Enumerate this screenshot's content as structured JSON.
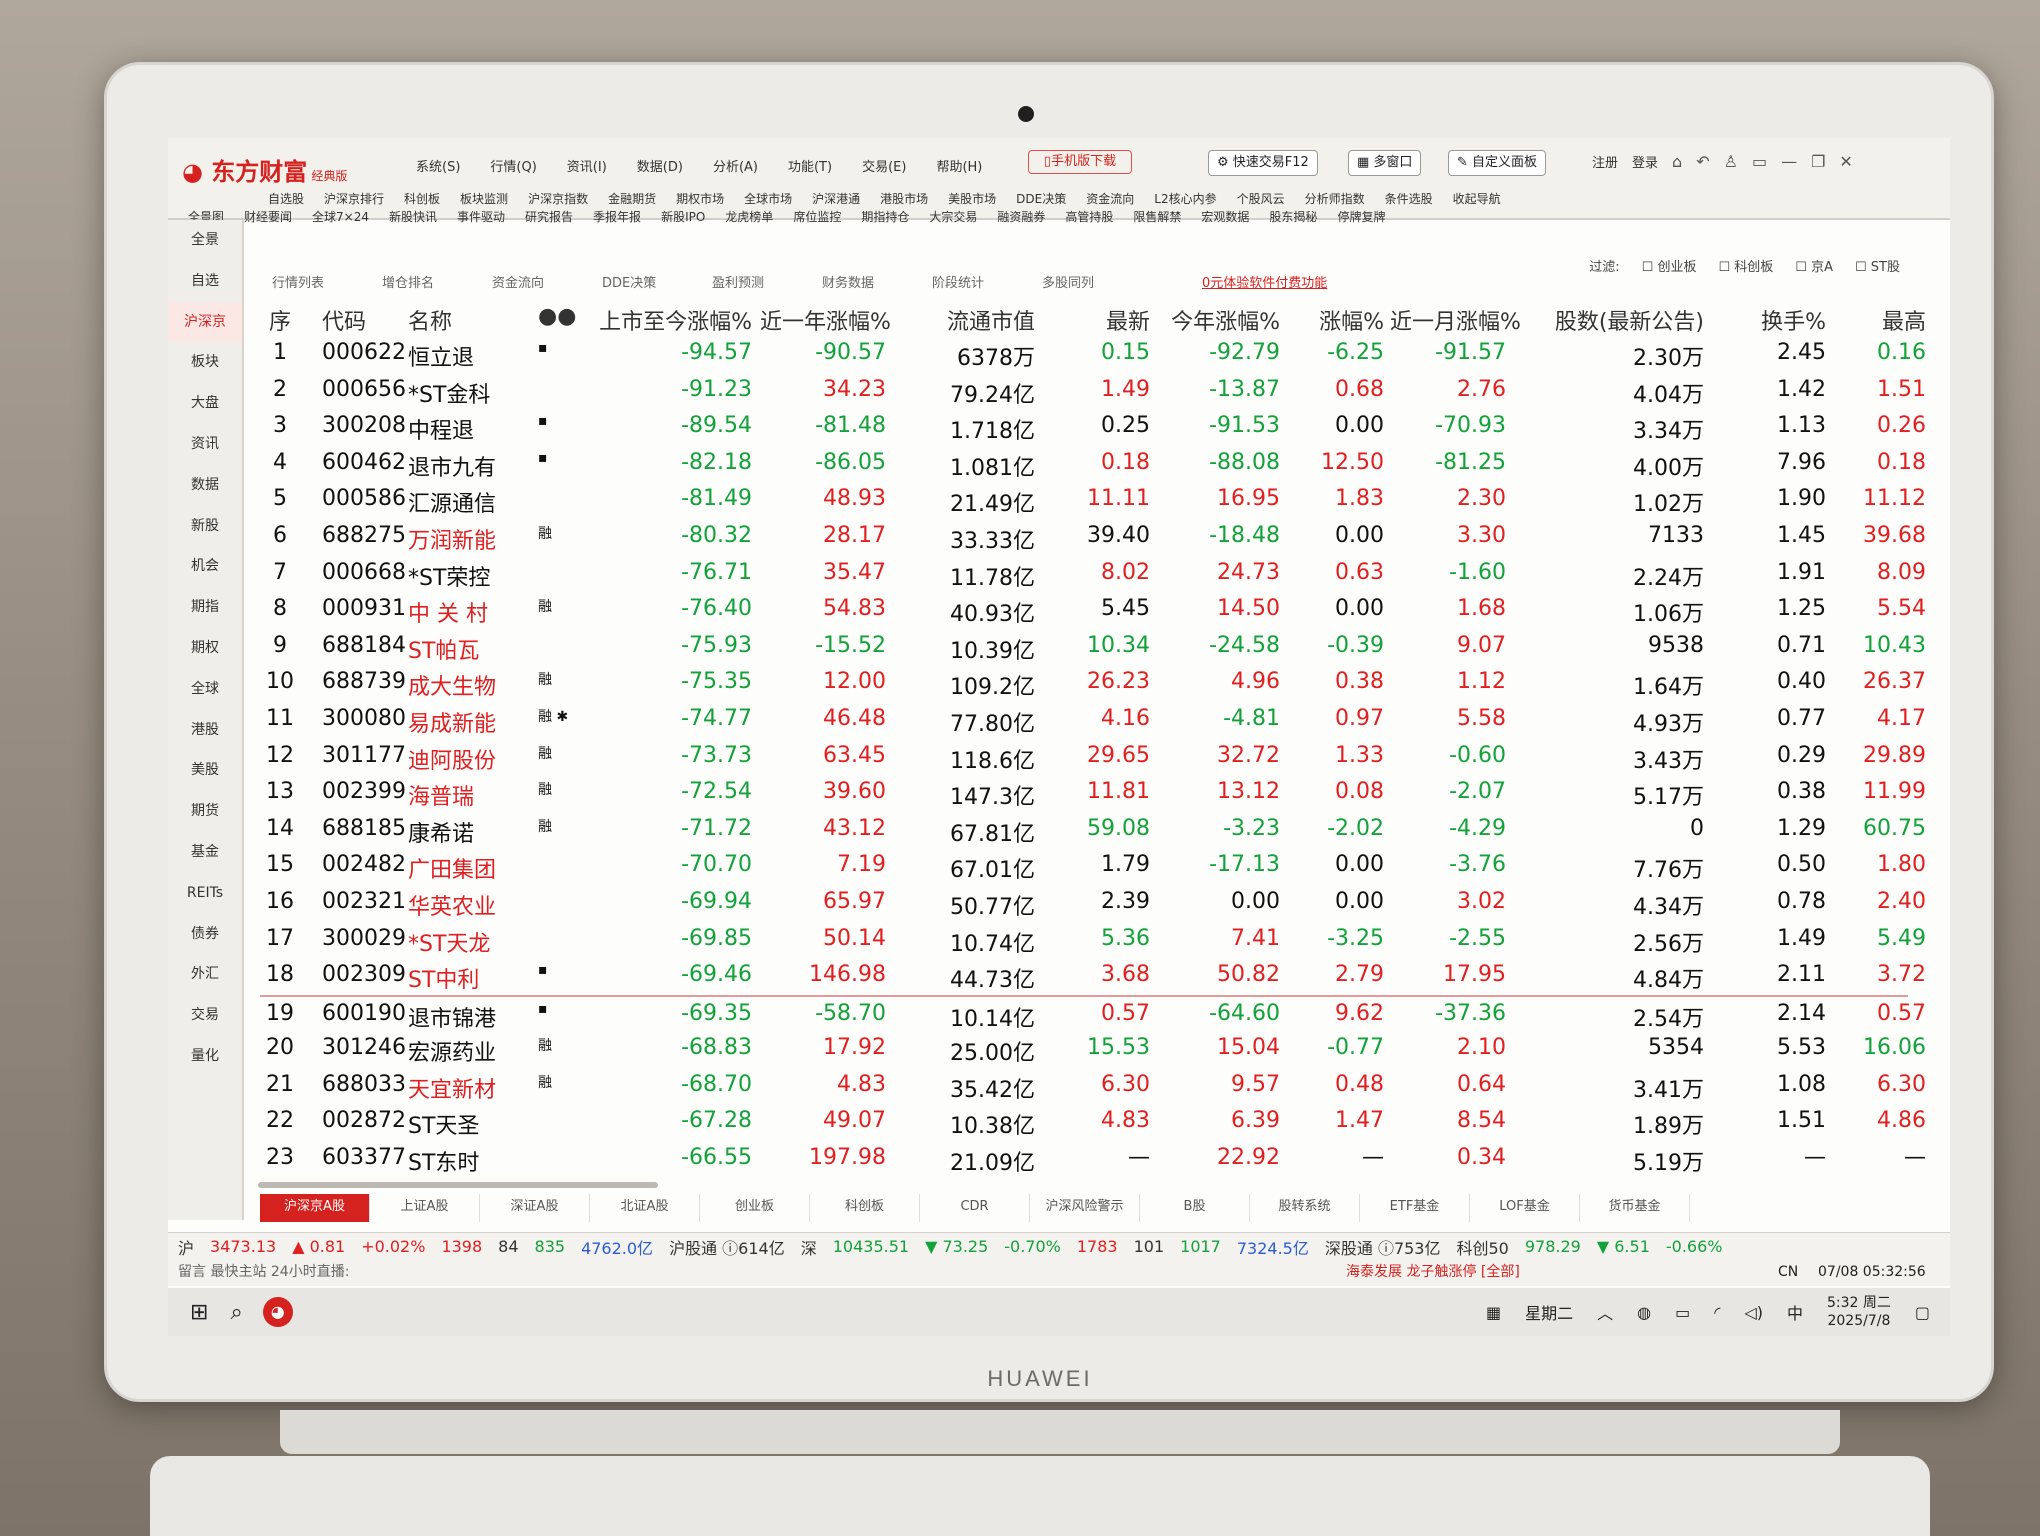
{
  "device": {
    "brand": "HUAWEI"
  },
  "app": {
    "logo": "东方财富",
    "logo_sub": "经典版",
    "menu": [
      "系统(S)",
      "行情(Q)",
      "资讯(I)",
      "数据(D)",
      "分析(A)",
      "功能(T)",
      "交易(E)",
      "帮助(H)"
    ],
    "mobile_download": "手机版下载",
    "quick_trade": "快速交易F12",
    "multi_window": "多窗口",
    "custom_panel": "自定义面板",
    "register": "注册",
    "login": "登录"
  },
  "subnav_row1": [
    "自选股",
    "沪深京排行",
    "科创板",
    "板块监测",
    "沪深京指数",
    "金融期货",
    "期权市场",
    "全球市场",
    "沪深港通",
    "港股市场",
    "美股市场",
    "DDE决策",
    "资金流向",
    "L2核心内参",
    "个股风云",
    "分析师指数",
    "条件选股",
    "收起导航"
  ],
  "subnav_row2": [
    "全景图",
    "财经要闻",
    "全球7×24",
    "新股快讯",
    "事件驱动",
    "研究报告",
    "季报年报",
    "新股IPO",
    "龙虎榜单",
    "席位监控",
    "期指持仓",
    "大宗交易",
    "融资融券",
    "高管持股",
    "限售解禁",
    "宏观数据",
    "股东揭秘",
    "停牌复牌"
  ],
  "sidebar": [
    "全景",
    "自选",
    "沪深京",
    "板块",
    "大盘",
    "资讯",
    "数据",
    "新股",
    "机会",
    "期指",
    "期权",
    "全球",
    "港股",
    "美股",
    "期货",
    "基金",
    "REITs",
    "债券",
    "外汇",
    "交易",
    "量化"
  ],
  "tabs": [
    "行情列表",
    "增仓排名",
    "资金流向",
    "DDE决策",
    "盈利预测",
    "财务数据",
    "阶段统计",
    "多股同列"
  ],
  "promo": "0元体验软件付费功能",
  "filter": {
    "label": "过滤:",
    "options": [
      "创业板",
      "科创板",
      "京A",
      "ST股"
    ]
  },
  "columns": {
    "seq": "序",
    "code": "代码",
    "name": "名称",
    "ipo_chg": "上市至今涨幅%",
    "yr1_chg": "近一年涨幅%",
    "mcap": "流通市值",
    "last": "最新",
    "ytd_chg": "今年涨幅%",
    "chg": "涨幅%",
    "m1_chg": "近一月涨幅%",
    "shares": "股数(最新公告)",
    "turnover": "换手%",
    "high": "最高"
  },
  "rows": [
    {
      "seq": "1",
      "code": "000622",
      "name": "恒立退",
      "mark": "▪",
      "ipo": "-94.57",
      "yr1": "-90.57",
      "mcap": "6378万",
      "last": "0.15",
      "ytd": "-92.79",
      "chg": "-6.25",
      "m1": "-91.57",
      "shares": "2.30万",
      "turn": "2.45",
      "high": "0.16"
    },
    {
      "seq": "2",
      "code": "000656",
      "name": "*ST金科",
      "mark": "",
      "ipo": "-91.23",
      "yr1": "34.23",
      "mcap": "79.24亿",
      "last": "1.49",
      "ytd": "-13.87",
      "chg": "0.68",
      "m1": "2.76",
      "shares": "4.04万",
      "turn": "1.42",
      "high": "1.51"
    },
    {
      "seq": "3",
      "code": "300208",
      "name": "中程退",
      "mark": "▪",
      "ipo": "-89.54",
      "yr1": "-81.48",
      "mcap": "1.718亿",
      "last": "0.25",
      "ytd": "-91.53",
      "chg": "0.00",
      "m1": "-70.93",
      "shares": "3.34万",
      "turn": "1.13",
      "high": "0.26"
    },
    {
      "seq": "4",
      "code": "600462",
      "name": "退市九有",
      "mark": "▪",
      "ipo": "-82.18",
      "yr1": "-86.05",
      "mcap": "1.081亿",
      "last": "0.18",
      "ytd": "-88.08",
      "chg": "12.50",
      "m1": "-81.25",
      "shares": "4.00万",
      "turn": "7.96",
      "high": "0.18"
    },
    {
      "seq": "5",
      "code": "000586",
      "name": "汇源通信",
      "mark": "",
      "ipo": "-81.49",
      "yr1": "48.93",
      "mcap": "21.49亿",
      "last": "11.11",
      "ytd": "16.95",
      "chg": "1.83",
      "m1": "2.30",
      "shares": "1.02万",
      "turn": "1.90",
      "high": "11.12"
    },
    {
      "seq": "6",
      "code": "688275",
      "name": "万润新能",
      "mark": "融",
      "ipo": "-80.32",
      "yr1": "28.17",
      "mcap": "33.33亿",
      "last": "39.40",
      "ytd": "-18.48",
      "chg": "0.00",
      "m1": "3.30",
      "shares": "7133",
      "turn": "1.45",
      "high": "39.68"
    },
    {
      "seq": "7",
      "code": "000668",
      "name": "*ST荣控",
      "mark": "",
      "ipo": "-76.71",
      "yr1": "35.47",
      "mcap": "11.78亿",
      "last": "8.02",
      "ytd": "24.73",
      "chg": "0.63",
      "m1": "-1.60",
      "shares": "2.24万",
      "turn": "1.91",
      "high": "8.09"
    },
    {
      "seq": "8",
      "code": "000931",
      "name": "中 关 村",
      "mark": "融",
      "ipo": "-76.40",
      "yr1": "54.83",
      "mcap": "40.93亿",
      "last": "5.45",
      "ytd": "14.50",
      "chg": "0.00",
      "m1": "1.68",
      "shares": "1.06万",
      "turn": "1.25",
      "high": "5.54"
    },
    {
      "seq": "9",
      "code": "688184",
      "name": "ST帕瓦",
      "mark": "",
      "ipo": "-75.93",
      "yr1": "-15.52",
      "mcap": "10.39亿",
      "last": "10.34",
      "ytd": "-24.58",
      "chg": "-0.39",
      "m1": "9.07",
      "shares": "9538",
      "turn": "0.71",
      "high": "10.43"
    },
    {
      "seq": "10",
      "code": "688739",
      "name": "成大生物",
      "mark": "融",
      "ipo": "-75.35",
      "yr1": "12.00",
      "mcap": "109.2亿",
      "last": "26.23",
      "ytd": "4.96",
      "chg": "0.38",
      "m1": "1.12",
      "shares": "1.64万",
      "turn": "0.40",
      "high": "26.37"
    },
    {
      "seq": "11",
      "code": "300080",
      "name": "易成新能",
      "mark": "融 ✱",
      "ipo": "-74.77",
      "yr1": "46.48",
      "mcap": "77.80亿",
      "last": "4.16",
      "ytd": "-4.81",
      "chg": "0.97",
      "m1": "5.58",
      "shares": "4.93万",
      "turn": "0.77",
      "high": "4.17"
    },
    {
      "seq": "12",
      "code": "301177",
      "name": "迪阿股份",
      "mark": "融",
      "ipo": "-73.73",
      "yr1": "63.45",
      "mcap": "118.6亿",
      "last": "29.65",
      "ytd": "32.72",
      "chg": "1.33",
      "m1": "-0.60",
      "shares": "3.43万",
      "turn": "0.29",
      "high": "29.89"
    },
    {
      "seq": "13",
      "code": "002399",
      "name": "海普瑞",
      "mark": "融",
      "ipo": "-72.54",
      "yr1": "39.60",
      "mcap": "147.3亿",
      "last": "11.81",
      "ytd": "13.12",
      "chg": "0.08",
      "m1": "-2.07",
      "shares": "5.17万",
      "turn": "0.38",
      "high": "11.99"
    },
    {
      "seq": "14",
      "code": "688185",
      "name": "康希诺",
      "mark": "融",
      "ipo": "-71.72",
      "yr1": "43.12",
      "mcap": "67.81亿",
      "last": "59.08",
      "ytd": "-3.23",
      "chg": "-2.02",
      "m1": "-4.29",
      "shares": "0",
      "turn": "1.29",
      "high": "60.75"
    },
    {
      "seq": "15",
      "code": "002482",
      "name": "广田集团",
      "mark": "",
      "ipo": "-70.70",
      "yr1": "7.19",
      "mcap": "67.01亿",
      "last": "1.79",
      "ytd": "-17.13",
      "chg": "0.00",
      "m1": "-3.76",
      "shares": "7.76万",
      "turn": "0.50",
      "high": "1.80"
    },
    {
      "seq": "16",
      "code": "002321",
      "name": "华英农业",
      "mark": "",
      "ipo": "-69.94",
      "yr1": "65.97",
      "mcap": "50.77亿",
      "last": "2.39",
      "ytd": "0.00",
      "chg": "0.00",
      "m1": "3.02",
      "shares": "4.34万",
      "turn": "0.78",
      "high": "2.40"
    },
    {
      "seq": "17",
      "code": "300029",
      "name": "*ST天龙",
      "mark": "",
      "ipo": "-69.85",
      "yr1": "50.14",
      "mcap": "10.74亿",
      "last": "5.36",
      "ytd": "7.41",
      "chg": "-3.25",
      "m1": "-2.55",
      "shares": "2.56万",
      "turn": "1.49",
      "high": "5.49"
    },
    {
      "seq": "18",
      "code": "002309",
      "name": "ST中利",
      "mark": "▪",
      "ipo": "-69.46",
      "yr1": "146.98",
      "mcap": "44.73亿",
      "last": "3.68",
      "ytd": "50.82",
      "chg": "2.79",
      "m1": "17.95",
      "shares": "4.84万",
      "turn": "2.11",
      "high": "3.72"
    },
    {
      "seq": "19",
      "code": "600190",
      "name": "退市锦港",
      "mark": "▪",
      "ipo": "-69.35",
      "yr1": "-58.70",
      "mcap": "10.14亿",
      "last": "0.57",
      "ytd": "-64.60",
      "chg": "9.62",
      "m1": "-37.36",
      "shares": "2.54万",
      "turn": "2.14",
      "high": "0.57"
    },
    {
      "seq": "20",
      "code": "301246",
      "name": "宏源药业",
      "mark": "融",
      "ipo": "-68.83",
      "yr1": "17.92",
      "mcap": "25.00亿",
      "last": "15.53",
      "ytd": "15.04",
      "chg": "-0.77",
      "m1": "2.10",
      "shares": "5354",
      "turn": "5.53",
      "high": "16.06"
    },
    {
      "seq": "21",
      "code": "688033",
      "name": "天宜新材",
      "mark": "融",
      "ipo": "-68.70",
      "yr1": "4.83",
      "mcap": "35.42亿",
      "last": "6.30",
      "ytd": "9.57",
      "chg": "0.48",
      "m1": "0.64",
      "shares": "3.41万",
      "turn": "1.08",
      "high": "6.30"
    },
    {
      "seq": "22",
      "code": "002872",
      "name": "ST天圣",
      "mark": "",
      "ipo": "-67.28",
      "yr1": "49.07",
      "mcap": "10.38亿",
      "last": "4.83",
      "ytd": "6.39",
      "chg": "1.47",
      "m1": "8.54",
      "shares": "1.89万",
      "turn": "1.51",
      "high": "4.86"
    },
    {
      "seq": "23",
      "code": "603377",
      "name": "ST东时",
      "mark": "",
      "ipo": "-66.55",
      "yr1": "197.98",
      "mcap": "21.09亿",
      "last": "—",
      "ytd": "22.92",
      "chg": "—",
      "m1": "0.34",
      "shares": "5.19万",
      "turn": "—",
      "high": "—"
    }
  ],
  "bottom_tabs": [
    "沪深京A股",
    "上证A股",
    "深证A股",
    "北证A股",
    "创业板",
    "科创板",
    "CDR",
    "沪深风险警示",
    "B股",
    "股转系统",
    "ETF基金",
    "LOF基金",
    "货币基金"
  ],
  "status": {
    "sh_label": "沪",
    "sh_index": "3473.13",
    "sh_chg": "▲ 0.81",
    "sh_pct": "+0.02%",
    "sh_up": "1398",
    "sh_flat": "84",
    "sh_down": "835",
    "sh_amount": "4762.0亿",
    "hgt": "沪股通 ⓘ614亿",
    "sz_label": "深",
    "sz_index": "10435.51",
    "sz_chg": "▼ 73.25",
    "sz_pct": "-0.70%",
    "sz_up": "1783",
    "sz_flat": "101",
    "sz_down": "1017",
    "sz_amount": "7324.5亿",
    "sgt": "深股通 ⓘ753亿",
    "kc_label": "科创50",
    "kc_index": "978.29",
    "kc_chg": "▼ 6.51",
    "kc_pct": "-0.66%"
  },
  "ticker": {
    "text": "留言  最快主站  24小时直播:",
    "news": "海泰发展 龙子触涨停 [全部]",
    "lang": "CN",
    "datetime": "07/08 05:32:56"
  },
  "taskbar": {
    "weekday": "星期二",
    "ime": "中",
    "time": "5:32 周二",
    "date": "2025/7/8"
  }
}
